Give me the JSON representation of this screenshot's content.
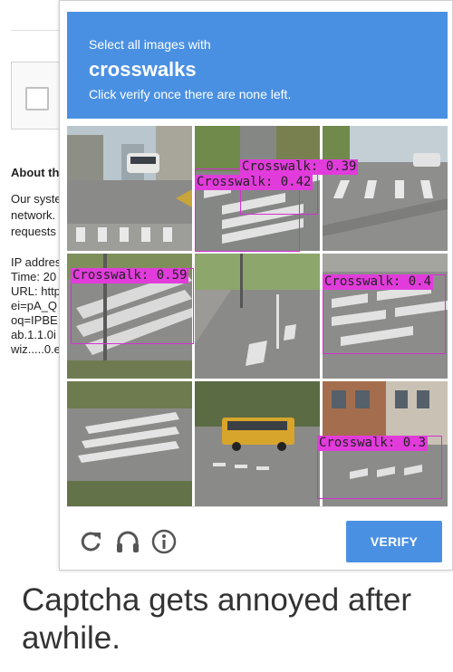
{
  "background_page": {
    "about_heading": "About th",
    "about_lines": [
      "Our syste",
      "network.",
      "requests"
    ],
    "ip_lines": [
      "IP addres",
      "Time: 20",
      "URL: http",
      "ei=pA_Q",
      "oq=IPBE",
      "ab.1.1.0i",
      "wiz.....0.e"
    ]
  },
  "captcha": {
    "instruction": "Select all images with",
    "keyword": "crosswalks",
    "sub_instruction": "Click verify once there are none left.",
    "header_color": "#4a90e2",
    "detections": [
      {
        "tile": 1,
        "label": "Crosswalk: 0.39"
      },
      {
        "tile": 1,
        "label": "Crosswalk: 0.42"
      },
      {
        "tile": 3,
        "label": "Crosswalk: 0.59"
      },
      {
        "tile": 5,
        "label": "Crosswalk: 0.4"
      },
      {
        "tile": 8,
        "label": "Crosswalk: 0.3"
      }
    ],
    "detection_color": "#e13cdb",
    "icons": [
      "reload-icon",
      "headphones-icon",
      "info-icon"
    ],
    "verify_label": "VERIFY"
  },
  "caption": "Captcha gets annoyed after awhile."
}
